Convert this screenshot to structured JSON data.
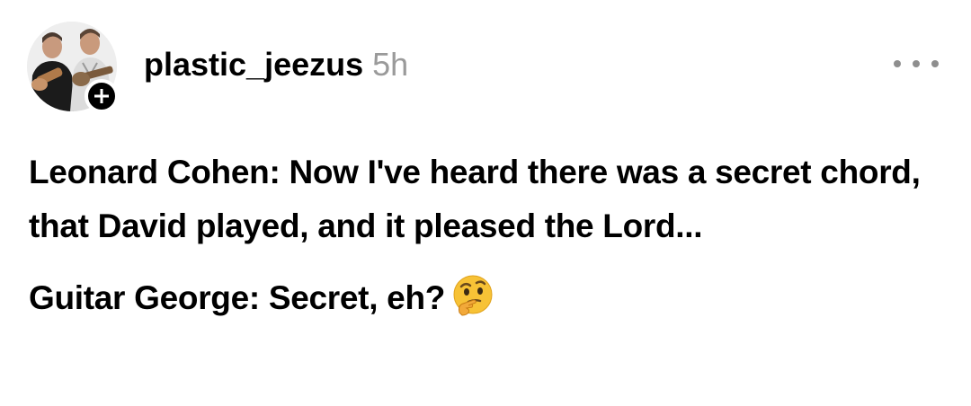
{
  "post": {
    "author": {
      "username": "plastic_jeezus",
      "time_ago": "5h",
      "avatar_icon": "avatar-photo",
      "follow_icon": "plus-icon"
    },
    "more_icon": "more-horizontal-icon",
    "paragraphs": [
      {
        "text": "Leonard Cohen: Now I've heard there was a secret chord, that David played, and it pleased the Lord..."
      },
      {
        "text": "Guitar George: Secret, eh?",
        "emoji_icon": "thinking-face-icon"
      }
    ],
    "colors": {
      "text": "#000000",
      "timestamp": "#9a9a9a",
      "more_dots": "#8e8e8e",
      "badge": "#000000",
      "background": "#ffffff"
    }
  }
}
